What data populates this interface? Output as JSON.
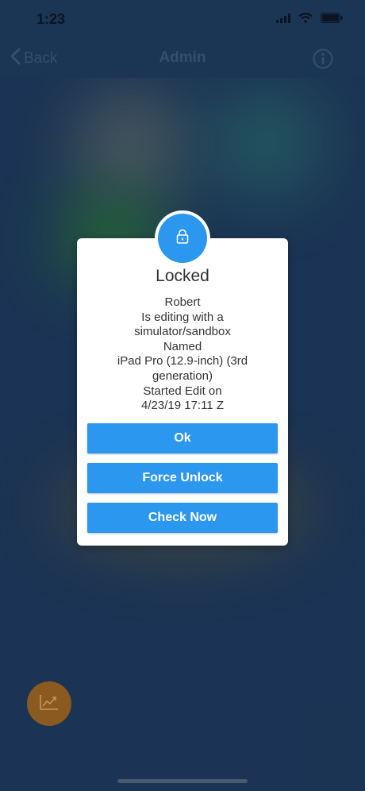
{
  "status_bar": {
    "time": "1:23",
    "icons": [
      "signal-icon",
      "wifi-icon",
      "battery-icon"
    ]
  },
  "nav": {
    "back_label": "Back",
    "title": "Admin",
    "info_icon": "info-icon"
  },
  "dialog": {
    "icon": "lock-icon",
    "title": "Locked",
    "message_lines": [
      "Robert",
      "Is editing with a",
      "simulator/sandbox",
      "Named",
      "iPad Pro (12.9-inch) (3rd",
      "generation)",
      "Started Edit on",
      "4/23/19 17:11 Z"
    ],
    "buttons": {
      "ok": "Ok",
      "force_unlock": "Force Unlock",
      "check_now": "Check Now"
    }
  },
  "fab": {
    "icon": "chart-trend-icon"
  },
  "colors": {
    "accent": "#2b97ef",
    "background": "#1f3a5c",
    "fab": "#8a5a20"
  }
}
